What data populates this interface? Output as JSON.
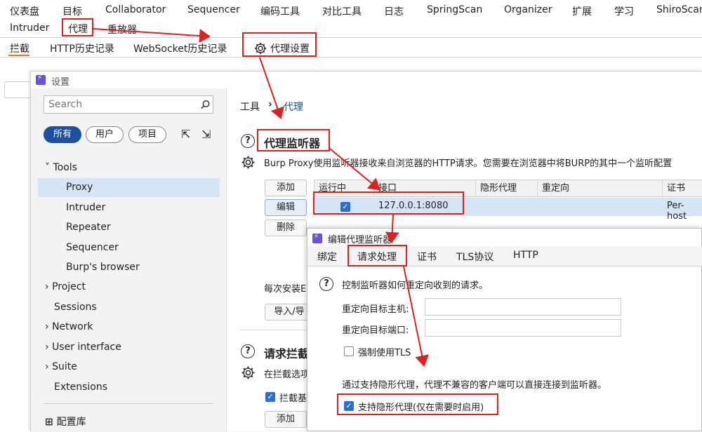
{
  "top_menu": {
    "row1": [
      "仪表盘",
      "目标",
      "Collaborator",
      "Sequencer",
      "编码工具",
      "对比工具",
      "日志",
      "SpringScan",
      "Organizer",
      "扩展",
      "学习",
      "ShiroScan"
    ],
    "row2": [
      "Intruder",
      "代理",
      "重放器"
    ]
  },
  "proxy_tabs": [
    "拦截",
    "HTTP历史记录",
    "WebSocket历史记录",
    "代理设置"
  ],
  "settings": {
    "title": "设置",
    "search_placeholder": "Search",
    "filters": [
      "所有",
      "用户",
      "项目"
    ],
    "tree": [
      "Tools",
      "Proxy",
      "Intruder",
      "Repeater",
      "Sequencer",
      "Burp's browser",
      "Project",
      "Sessions",
      "Network",
      "User interface",
      "Suite",
      "Extensions"
    ],
    "library": "配置库",
    "breadcrumb": [
      "工具",
      "代理"
    ],
    "section1_title": "代理监听器",
    "section1_desc": "Burp Proxy使用监听器接收来自浏览器的HTTP请求。您需要在浏览器中将BURP的其中一个监听配置",
    "buttons": [
      "添加",
      "编辑",
      "删除"
    ],
    "table_headers": [
      "运行中",
      "接口",
      "隐形代理",
      "重定向",
      "证书"
    ],
    "row": {
      "iface": "127.0.0.1:8080",
      "cert": "Per-host"
    },
    "install_text": "每次安装E",
    "import_btn": "导入/导",
    "section2_title": "请求拦截",
    "section2_desc": "在拦截选项",
    "intercept_cb": "拦截基",
    "add_btn": "添加"
  },
  "dialog": {
    "title": "编辑代理监听器",
    "tabs": [
      "绑定",
      "请求处理",
      "证书",
      "TLS协议",
      "HTTP"
    ],
    "help": "控制监听器如何重定向收到的请求。",
    "redirect_host_label": "重定向目标主机:",
    "redirect_port_label": "重定向目标端口:",
    "force_tls": "强制使用TLS",
    "invisible_desc": "通过支持隐形代理，代理不兼容的客户端可以直接连接到监听器。",
    "invisible_cb": "支持隐形代理(仅在需要时启用)"
  },
  "colors": {
    "annotation": "#e02020",
    "selected": "#d5e5f7",
    "accent": "#2a6fd6"
  }
}
